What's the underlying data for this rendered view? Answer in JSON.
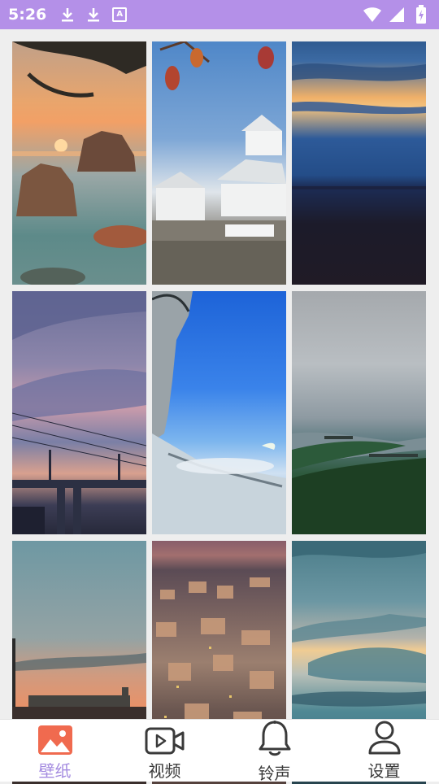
{
  "status_bar": {
    "time": "5:26",
    "left_icons": [
      "download-icon",
      "download-icon",
      "text-a-icon"
    ],
    "badge_letter": "A",
    "right_icons": [
      "wifi-icon",
      "signal-icon",
      "battery-charging-icon"
    ],
    "background_color": "#b490e8"
  },
  "wallpapers": [
    {
      "name": "coastal-sunset-rocks"
    },
    {
      "name": "white-castle"
    },
    {
      "name": "blue-dusk-horizon"
    },
    {
      "name": "evening-bridge-clouds"
    },
    {
      "name": "anime-character-sky"
    },
    {
      "name": "misty-river-valley"
    },
    {
      "name": "seaside-sunset-pier"
    },
    {
      "name": "hillside-city-night"
    },
    {
      "name": "golden-cloud-sky"
    }
  ],
  "tabs": [
    {
      "label": "壁纸",
      "icon": "image-icon",
      "active": true
    },
    {
      "label": "视频",
      "icon": "video-camera-icon",
      "active": false
    },
    {
      "label": "铃声",
      "icon": "bell-icon",
      "active": false
    },
    {
      "label": "设置",
      "icon": "person-icon",
      "active": false
    }
  ],
  "colors": {
    "accent": "#a48be0",
    "active_icon": "#f06a4f",
    "inactive_icon": "#3a3a3a",
    "tab_bar_background": "#ffffff",
    "page_background": "#eeeeee"
  }
}
